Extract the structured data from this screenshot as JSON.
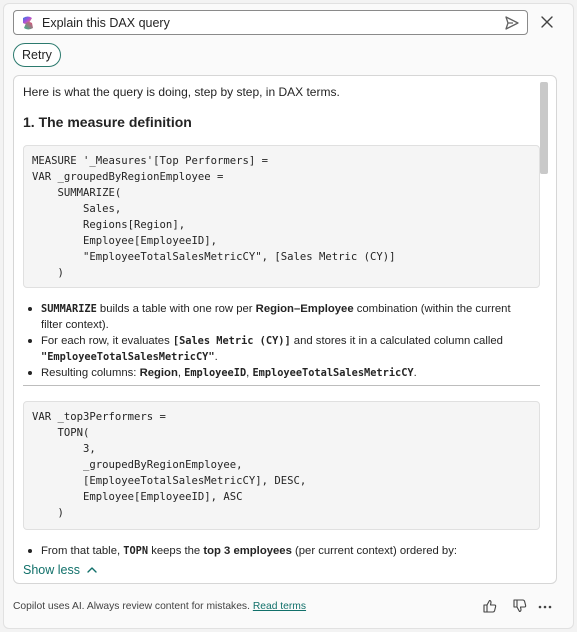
{
  "prompt": {
    "text": "Explain this DAX query",
    "icons": {
      "logo": "copilot-logo-icon",
      "send": "send-icon",
      "close": "close-icon"
    }
  },
  "retry_label": "Retry",
  "response": {
    "intro": "Here is what the query is doing, step by step, in DAX terms.",
    "heading": "1. The measure definition",
    "code1": "MEASURE '_Measures'[Top Performers] =\nVAR _groupedByRegionEmployee =\n    SUMMARIZE(\n        Sales,\n        Regions[Region],\n        Employee[EmployeeID],\n        \"EmployeeTotalSalesMetricCY\", [Sales Metric (CY)]\n    )",
    "bullets1": [
      {
        "term": "SUMMARIZE",
        "text1": " builds a table with one row per ",
        "bold": "Region–Employee",
        "text2": " combination (within the current filter context)."
      },
      {
        "text1": "For each row, it evaluates ",
        "code": "[Sales Metric (CY)]",
        "text2": " and stores it in a calculated column called ",
        "code2": "\"EmployeeTotalSalesMetricCY\"",
        "text3": "."
      },
      {
        "text1": "Resulting columns: ",
        "c1": "Region",
        "sep1": ", ",
        "c2": "EmployeeID",
        "sep2": ", ",
        "c3": "EmployeeTotalSalesMetricCY",
        "end": "."
      }
    ],
    "code2": "VAR _top3Performers =\n    TOPN(\n        3,\n        _groupedByRegionEmployee,\n        [EmployeeTotalSalesMetricCY], DESC,\n        Employee[EmployeeID], ASC\n    )",
    "bullets2": [
      {
        "text1": "From that table, ",
        "term": "TOPN",
        "text2": " keeps the ",
        "bold": "top 3 employees",
        "text3": " (per current context) ordered by:"
      }
    ],
    "show_less": "Show less"
  },
  "footer": {
    "note": "Copilot uses AI. Always review content for mistakes.",
    "link": "Read terms",
    "icons": [
      "thumbs-up-icon",
      "thumbs-down-icon",
      "more-icon"
    ]
  },
  "colors": {
    "accent": "#11706a",
    "retry_border": "#2c7a6e"
  }
}
